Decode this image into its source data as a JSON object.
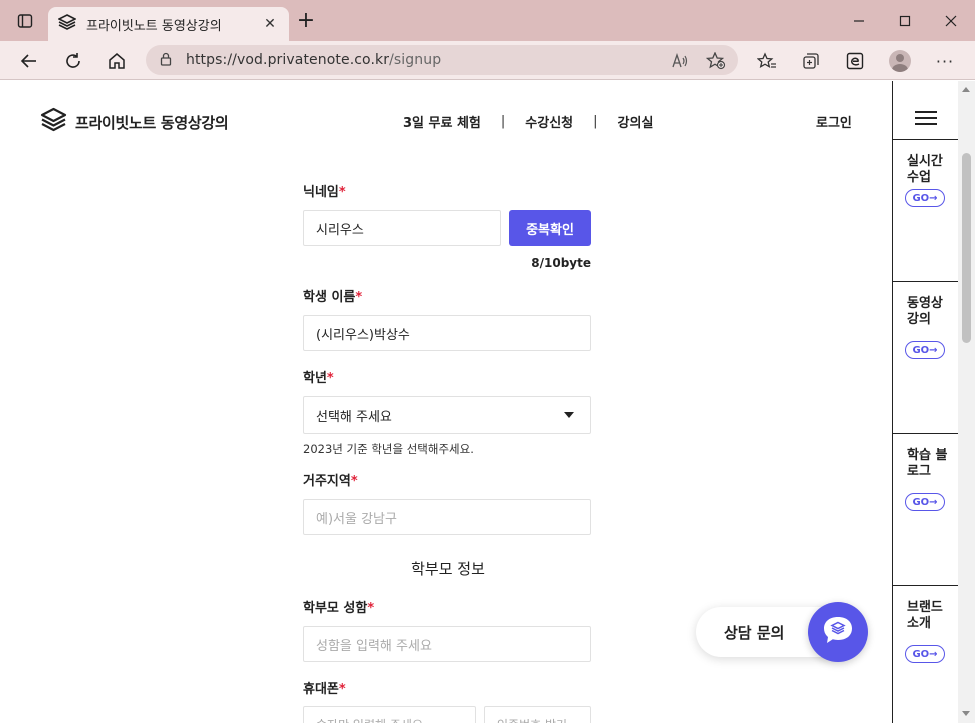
{
  "browser": {
    "tab_title": "프라이빗노트 동영상강의",
    "url_host": "https://vod.privatenote.co.kr",
    "url_path": "/signup",
    "icons": [
      "tab-actions-icon",
      "site-logo-icon",
      "close-icon",
      "plus-icon",
      "minimize-icon",
      "maximize-icon",
      "window-close-icon",
      "back-icon",
      "refresh-icon",
      "home-icon",
      "lock-icon",
      "read-aloud-icon",
      "favorite-add-icon",
      "favorites-icon",
      "collections-icon",
      "edge-icon",
      "profile-icon",
      "more-icon"
    ]
  },
  "header": {
    "brand_name": "프라이빗노트 동영상강의",
    "nav": [
      "3일 무료 체험",
      "수강신청",
      "강의실"
    ],
    "separator": "|",
    "login": "로그인"
  },
  "form": {
    "nickname": {
      "label": "닉네임",
      "required": "*",
      "value": "시리우스",
      "button": "중복확인",
      "byte_count": "8/10byte"
    },
    "student_name": {
      "label": "학생 이름",
      "required": "*",
      "value": "(시리우스)박상수"
    },
    "grade": {
      "label": "학년",
      "required": "*",
      "value": "선택해 주세요",
      "hint": "2023년 기준 학년을 선택해주세요."
    },
    "region": {
      "label": "거주지역",
      "required": "*",
      "placeholder": "예)서울 강남구"
    },
    "parent_section_title": "학부모 정보",
    "parent_name": {
      "label": "학부모 성함",
      "required": "*",
      "placeholder": "성함을 입력해 주세요"
    },
    "phone": {
      "label": "휴대폰",
      "required": "*",
      "placeholder": "숫자만 입력해 주세요",
      "verify_placeholder": "인증번호 받기"
    }
  },
  "chat": {
    "label": "상담 문의"
  },
  "sidebar": {
    "items": [
      {
        "label": "실시간 수업",
        "go": "GO"
      },
      {
        "label": "동영상 강의",
        "go": "GO"
      },
      {
        "label": "학습 블로그",
        "go": "GO"
      },
      {
        "label": "브랜드 소개",
        "go": "GO"
      }
    ]
  },
  "colors": {
    "accent": "#5856e8",
    "required": "#e0233a",
    "chrome": "#dcbcbc"
  }
}
